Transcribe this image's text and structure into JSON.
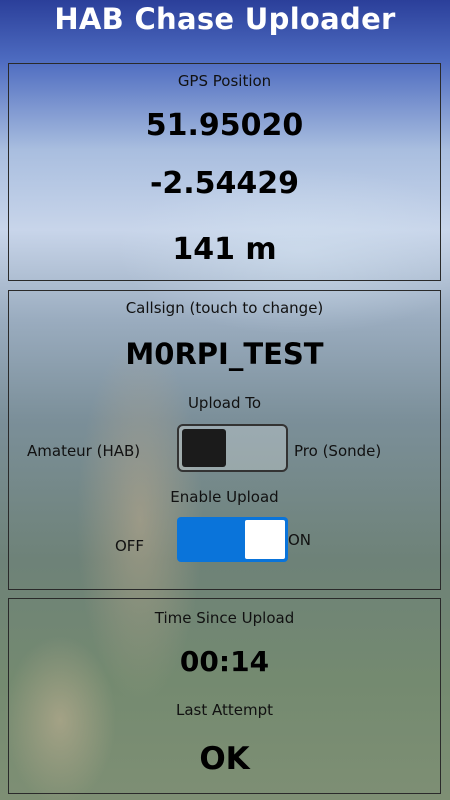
{
  "app": {
    "title": "HAB Chase Uploader"
  },
  "gps": {
    "heading": "GPS Position",
    "latitude": "51.95020",
    "longitude": "-2.54429",
    "altitude": "141 m"
  },
  "callsign": {
    "heading": "Callsign (touch to change)",
    "value": "M0RPI_TEST"
  },
  "upload_to": {
    "heading": "Upload To",
    "left_label": "Amateur (HAB)",
    "right_label": "Pro (Sonde)",
    "state": "Amateur (HAB)"
  },
  "enable_upload": {
    "heading": "Enable Upload",
    "off_label": "OFF",
    "on_label": "ON",
    "state": "ON",
    "accent_color": "#0a74da"
  },
  "status": {
    "time_heading": "Time Since Upload",
    "time_value": "00:14",
    "attempt_heading": "Last Attempt",
    "attempt_value": "OK"
  }
}
